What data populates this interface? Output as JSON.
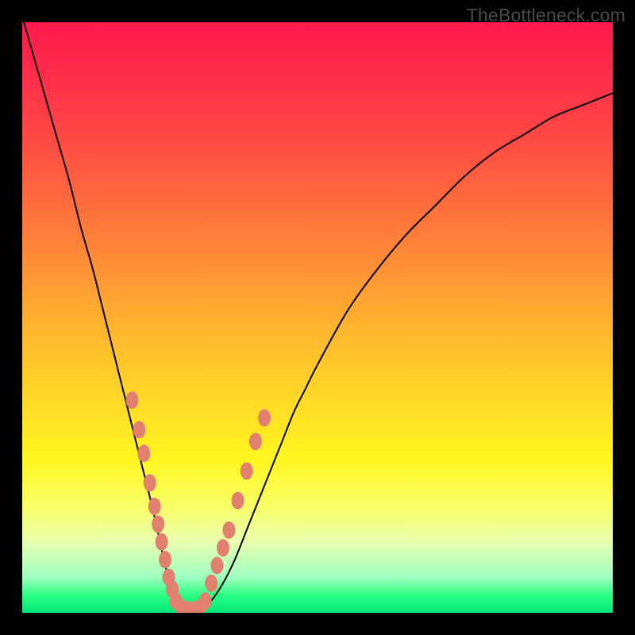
{
  "watermark": "TheBottleneck.com",
  "colors": {
    "frame": "#000000",
    "curve": "#000000",
    "bead": "#e2806f",
    "gradient_stops": [
      "#ff1a4d",
      "#ff2a4a",
      "#ff4a44",
      "#ff7a3a",
      "#ffa831",
      "#ffd428",
      "#fff61f",
      "#f9ff66",
      "#e9ffb0",
      "#9fffc0",
      "#2cff83",
      "#00e879"
    ]
  },
  "chart_data": {
    "type": "line",
    "title": "",
    "xlabel": "",
    "ylabel": "",
    "xlim": [
      0,
      100
    ],
    "ylim": [
      0,
      100
    ],
    "x": [
      0,
      2,
      4,
      6,
      8,
      10,
      12,
      14,
      16,
      18,
      20,
      22,
      24,
      25,
      26,
      27,
      28,
      30,
      32,
      34,
      36,
      38,
      40,
      42,
      44,
      46,
      48,
      50,
      55,
      60,
      65,
      70,
      75,
      80,
      85,
      90,
      95,
      100
    ],
    "y": [
      101,
      94,
      87,
      80,
      73,
      65,
      58,
      50,
      42,
      34,
      26,
      18,
      9,
      5,
      2,
      0,
      0,
      0,
      2,
      5,
      9,
      14,
      19,
      24,
      29,
      34,
      38,
      42,
      51,
      58,
      64,
      69,
      74,
      78,
      81,
      84,
      86,
      88
    ],
    "annotations": {
      "beads_left": [
        [
          18.6,
          36
        ],
        [
          19.8,
          31
        ],
        [
          20.6,
          27
        ],
        [
          21.6,
          22
        ],
        [
          22.4,
          18
        ],
        [
          23.0,
          15
        ],
        [
          23.6,
          12
        ],
        [
          24.2,
          9
        ],
        [
          24.8,
          6
        ],
        [
          25.4,
          4
        ],
        [
          26.0,
          2
        ],
        [
          27.0,
          0.8
        ],
        [
          28.0,
          0.5
        ]
      ],
      "beads_right": [
        [
          29.0,
          0.5
        ],
        [
          30.0,
          0.8
        ],
        [
          31.0,
          2
        ],
        [
          32.0,
          5
        ],
        [
          33.0,
          8
        ],
        [
          34.0,
          11
        ],
        [
          35.0,
          14
        ],
        [
          36.5,
          19
        ],
        [
          38.0,
          24
        ],
        [
          39.5,
          29
        ],
        [
          41.0,
          33
        ]
      ]
    }
  }
}
